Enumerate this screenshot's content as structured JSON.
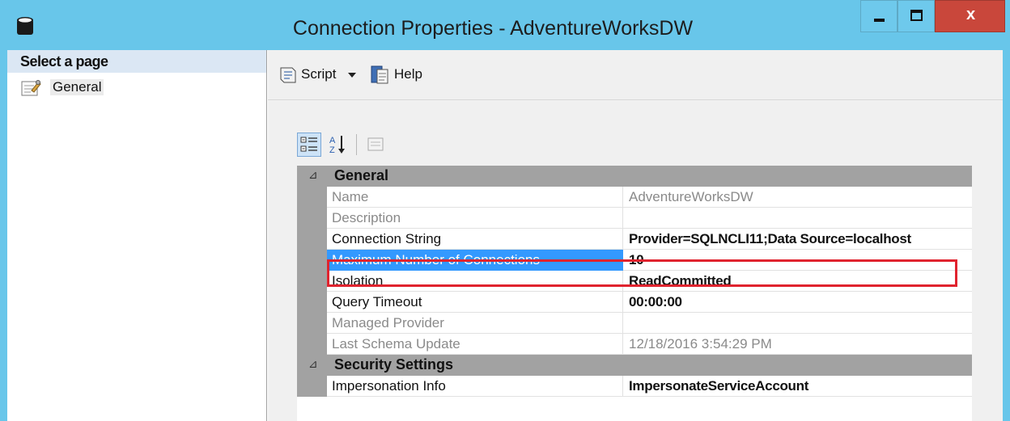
{
  "window": {
    "title": "Connection Properties - AdventureWorksDW",
    "close_glyph": "x"
  },
  "left_pane": {
    "header": "Select a page",
    "pages": [
      {
        "label": "General",
        "icon": "wrench-page-icon"
      }
    ]
  },
  "toolbar": {
    "script_label": "Script",
    "help_label": "Help"
  },
  "property_grid": {
    "categories": [
      {
        "name": "General",
        "rows": [
          {
            "name": "Name",
            "value": "AdventureWorksDW",
            "readonly": true
          },
          {
            "name": "Description",
            "value": "",
            "readonly": true
          },
          {
            "name": "Connection String",
            "value": "Provider=SQLNCLI11;Data Source=localhost",
            "readonly": false
          },
          {
            "name": "Maximum Number of Connections",
            "value": "10",
            "readonly": false,
            "selected": true
          },
          {
            "name": "Isolation",
            "value": "ReadCommitted",
            "readonly": false
          },
          {
            "name": "Query Timeout",
            "value": "00:00:00",
            "readonly": false
          },
          {
            "name": "Managed Provider",
            "value": "",
            "readonly": true
          },
          {
            "name": "Last Schema Update",
            "value": "12/18/2016 3:54:29 PM",
            "readonly": true
          }
        ]
      },
      {
        "name": "Security Settings",
        "rows": [
          {
            "name": "Impersonation Info",
            "value": "ImpersonateServiceAccount",
            "readonly": false
          }
        ]
      }
    ]
  },
  "colors": {
    "titlebar": "#68c6ea",
    "close_button": "#c9473b",
    "selection": "#3399ff",
    "highlight_box": "#e0232e",
    "category_band": "#a2a2a2"
  }
}
